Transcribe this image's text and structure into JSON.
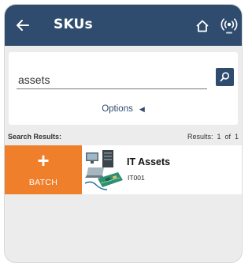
{
  "header": {
    "title": "SKUs",
    "back_icon": "arrow-left-icon",
    "home_icon": "home-icon",
    "rfid_icon": "rfid-signal-icon",
    "bar_color": "#2f4c6e"
  },
  "search": {
    "value": "assets",
    "button_icon": "search-icon",
    "options_label": "Options",
    "options_icon": "caret-left-icon"
  },
  "results": {
    "label": "Search Results:",
    "count_text": "Results:  1  of  1",
    "items": [
      {
        "batch_symbol": "+",
        "batch_label": "BATCH",
        "thumbnail_icon": "it-equipment-icon",
        "name": "IT Assets",
        "code": "IT001"
      }
    ]
  },
  "colors": {
    "accent": "#f07f2b",
    "background": "#ececec"
  }
}
